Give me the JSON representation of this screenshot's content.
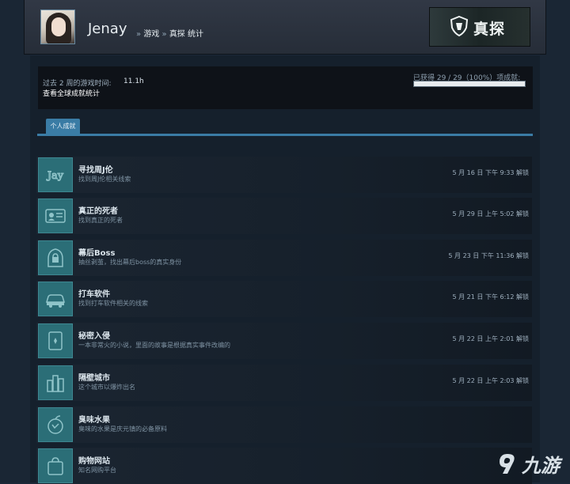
{
  "header": {
    "username": "Jenay",
    "breadcrumb_sep": "»",
    "breadcrumb_1": "游戏",
    "breadcrumb_2": "真探 统计",
    "game_logo_text": "真探"
  },
  "stats": {
    "playtime_label": "过去 2 周的游戏时间:",
    "playtime_value": "11.1h",
    "global_link": "查看全球成就统计",
    "achieved_text": "已获得 29 / 29（100%）项成就:",
    "progress_fraction": 1.0
  },
  "tabs": {
    "personal": "个人成就"
  },
  "achievements": [
    {
      "name": "寻找周J伦",
      "desc": "找到周J伦相关线索",
      "date": "5 月 16 日 下午 9:33 解锁",
      "icon": "jay-text-icon"
    },
    {
      "name": "真正的死者",
      "desc": "找到真正的死者",
      "date": "5 月 29 日 上午 5:02 解锁",
      "icon": "id-card-icon"
    },
    {
      "name": "幕后Boss",
      "desc": "抽丝剥茧，找出幕后boss的真实身份",
      "date": "5 月 23 日 下午 11:36 解锁",
      "icon": "hooded-figure-icon"
    },
    {
      "name": "打车软件",
      "desc": "找到打车软件相关的线索",
      "date": "5 月 21 日 下午 6:12 解锁",
      "icon": "car-icon"
    },
    {
      "name": "秘密入侵",
      "desc": "一本非常火的小说，里面的故事是根据真实事件改编的",
      "date": "5 月 22 日 上午 2:01 解锁",
      "icon": "book-icon"
    },
    {
      "name": "隔壁城市",
      "desc": "这个城市以爆炸出名",
      "date": "5 月 22 日 上午 2:03 解锁",
      "icon": "city-icon"
    },
    {
      "name": "臭味水果",
      "desc": "臭味的水果是庆元镇的必备原料",
      "date": "",
      "icon": "fruit-icon"
    },
    {
      "name": "购物网站",
      "desc": "知名网购平台",
      "date": "",
      "icon": "shopping-bag-icon"
    }
  ],
  "watermark": {
    "text": "九游"
  },
  "colors": {
    "accent": "#3a7ca5",
    "icon_bg": "#2b6e77",
    "page_bg": "#1b2838"
  }
}
